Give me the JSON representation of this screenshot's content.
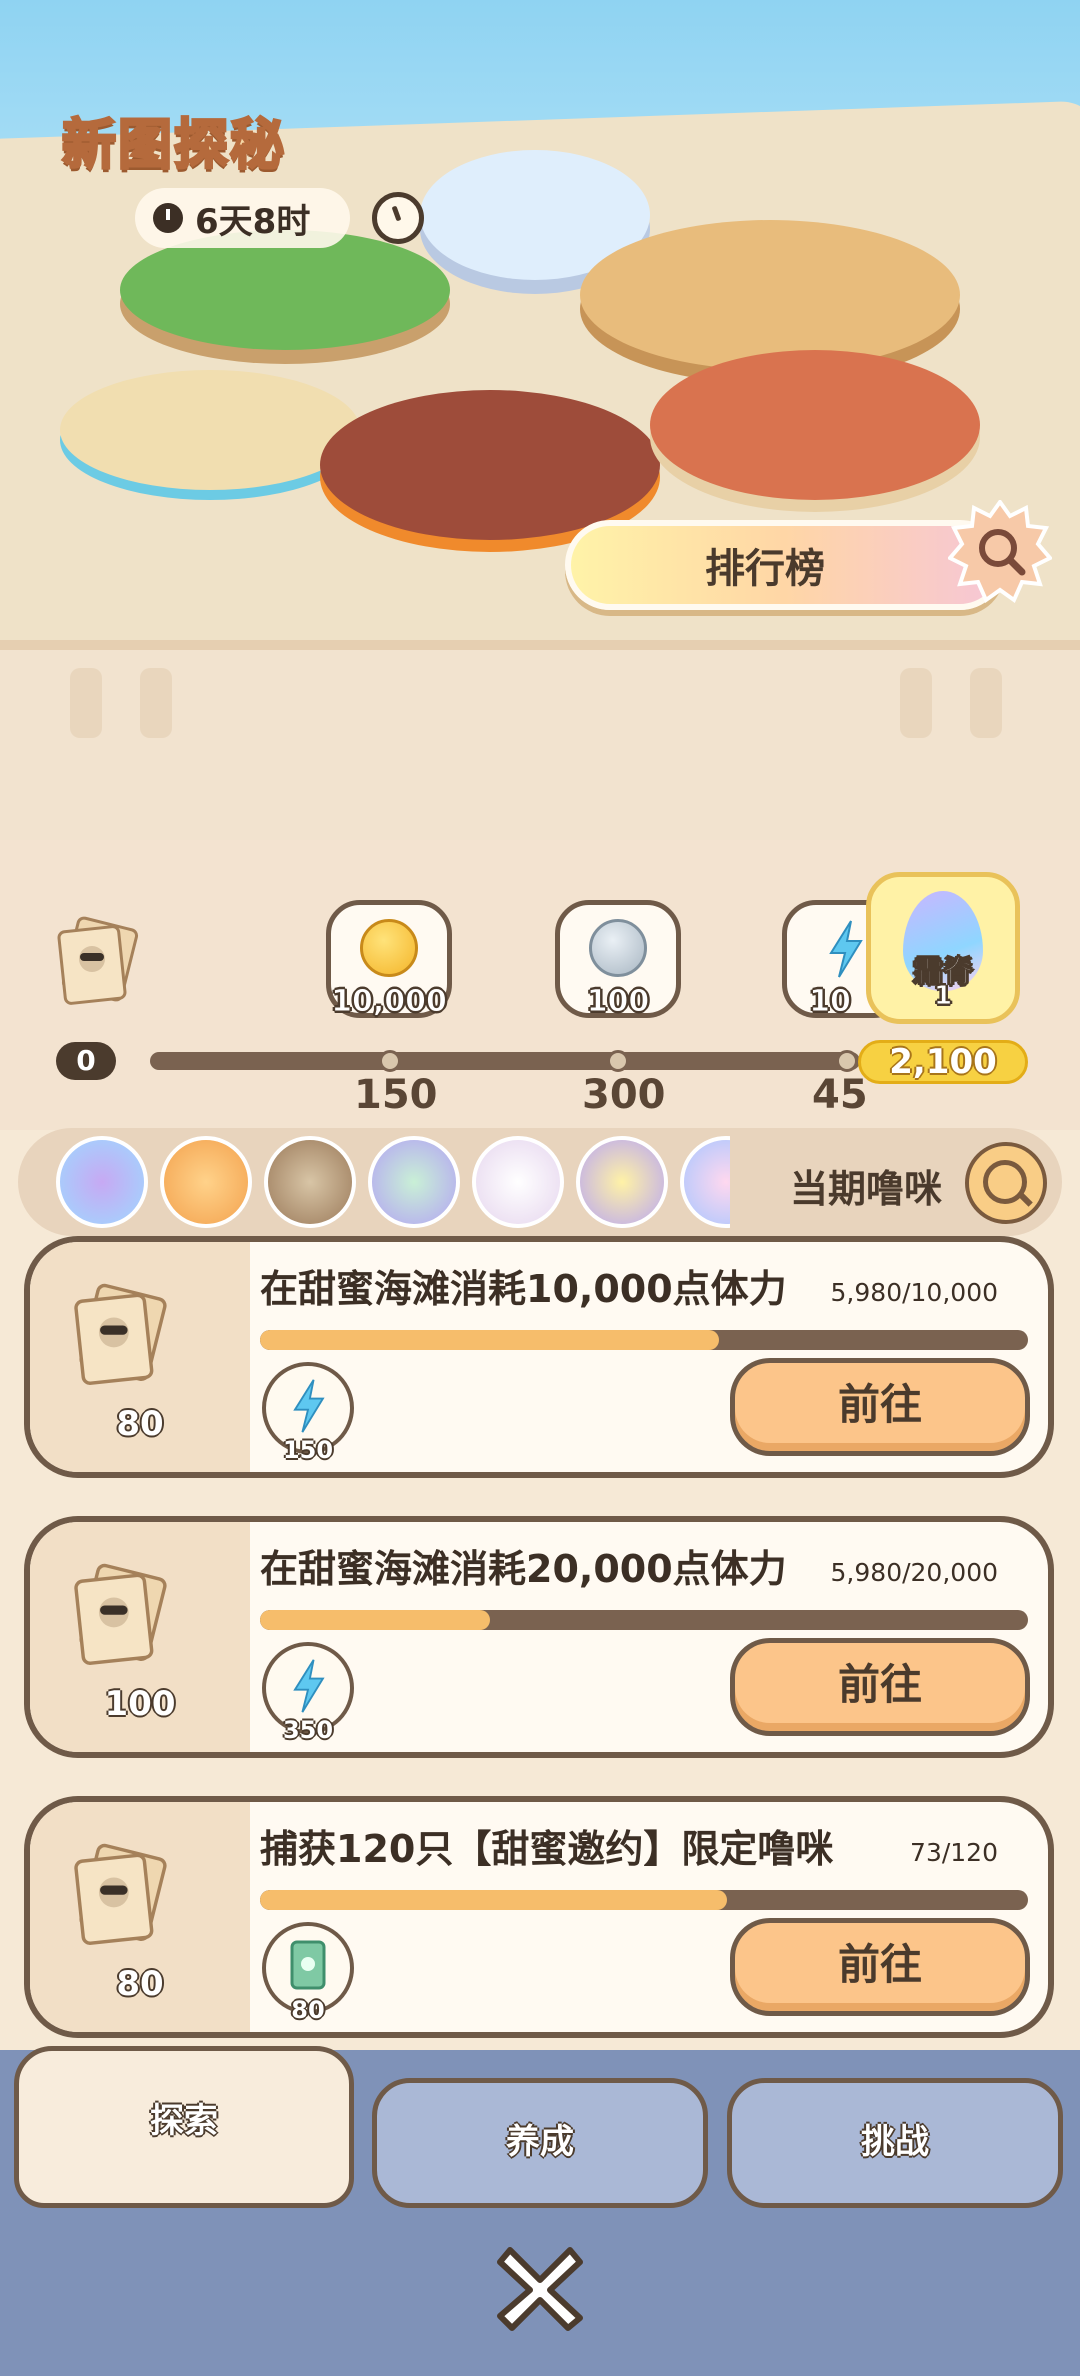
{
  "header": {
    "title": "新图探秘",
    "timer": "6天8时"
  },
  "leaderboard_label": "排行榜",
  "progress": {
    "start": "0",
    "rewards": [
      {
        "label": "10,000",
        "icon": "gold-coin-icon"
      },
      {
        "label": "100",
        "icon": "silver-coin-icon"
      },
      {
        "label": "10",
        "icon": "energy-icon"
      }
    ],
    "ticks": [
      "150",
      "300",
      "45"
    ],
    "final_reward": {
      "name": "霜脊",
      "count": "1"
    },
    "current": "2,100"
  },
  "current_pets_label": "当期噜咪",
  "tasks": [
    {
      "count": "80",
      "title": "在甜蜜海滩消耗10,000点体力",
      "progress": "5,980/10,000",
      "fraction": 0.598,
      "reward_count": "150",
      "reward_icon": "energy-icon",
      "button": "前往"
    },
    {
      "count": "100",
      "title": "在甜蜜海滩消耗20,000点体力",
      "progress": "5,980/20,000",
      "fraction": 0.299,
      "reward_count": "350",
      "reward_icon": "energy-icon",
      "button": "前往"
    },
    {
      "count": "80",
      "title": "捕获120只【甜蜜邀约】限定噜咪",
      "progress": "73/120",
      "fraction": 0.608,
      "reward_count": "80",
      "reward_icon": "card-icon",
      "button": "前往"
    }
  ],
  "tabs": [
    {
      "label": "探索",
      "active": true
    },
    {
      "label": "养成",
      "active": false
    },
    {
      "label": "挑战",
      "active": false
    }
  ],
  "colors": {
    "accent": "#fcc58a",
    "bar_fill": "#f6bd6b",
    "outline": "#6f5a48",
    "tab_bg": "#7f92b8"
  }
}
